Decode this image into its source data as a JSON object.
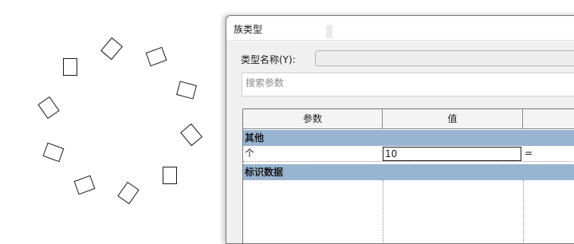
{
  "dialog": {
    "title": "族类型",
    "type_name_label": "类型名称(Y):",
    "type_name_value": "",
    "search_placeholder": "搜索参数"
  },
  "grid": {
    "columns": [
      "参数",
      "值",
      ""
    ],
    "groups": [
      {
        "name": "其他",
        "rows": [
          {
            "param": "个",
            "value": "10",
            "formula": "="
          }
        ]
      },
      {
        "name": "标识数据",
        "rows": []
      }
    ]
  },
  "icons": {
    "canvas_shape": "rectangle-instance-icon"
  }
}
